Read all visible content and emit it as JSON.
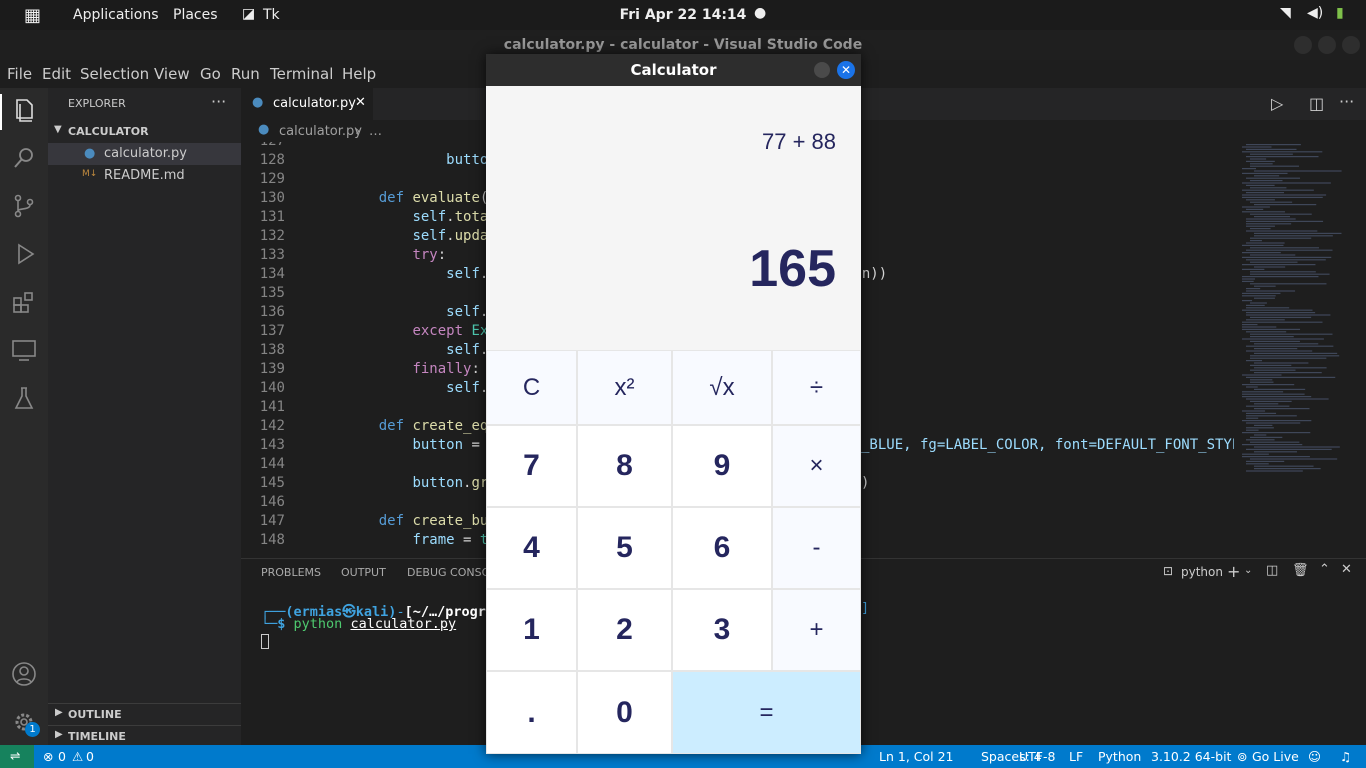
{
  "topbar": {
    "applications": "Applications",
    "places": "Places",
    "app": "Tk",
    "clock": "Fri Apr 22  14:14"
  },
  "window": {
    "title": "calculator.py - calculator - Visual Studio Code"
  },
  "menu": [
    "File",
    "Edit",
    "Selection",
    "View",
    "Go",
    "Run",
    "Terminal",
    "Help"
  ],
  "explorer": {
    "header": "EXPLORER",
    "folder": "CALCULATOR",
    "files": [
      "calculator.py",
      "README.md"
    ],
    "outline": "OUTLINE",
    "timeline": "TIMELINE"
  },
  "editor": {
    "tab": "calculator.py",
    "breadcrumb_file": "calculator.py",
    "breadcrumb_more": "…",
    "lines": [
      {
        "n": "127",
        "i": "",
        "t": ""
      },
      {
        "n": "128",
        "i": "            ",
        "t": "button.grid(r"
      },
      {
        "n": "129",
        "i": "",
        "t": ""
      },
      {
        "n": "130",
        "i": "    ",
        "t": "def evaluate(self"
      },
      {
        "n": "131",
        "i": "        ",
        "t": "self.total_ex"
      },
      {
        "n": "132",
        "i": "        ",
        "t": "self.update_t"
      },
      {
        "n": "133",
        "i": "        ",
        "t": "try:"
      },
      {
        "n": "134",
        "i": "            ",
        "t": "self.curr"
      },
      {
        "n": "135",
        "i": "",
        "t": ""
      },
      {
        "n": "136",
        "i": "            ",
        "t": "self.tota"
      },
      {
        "n": "137",
        "i": "        ",
        "t": "except Except"
      },
      {
        "n": "138",
        "i": "            ",
        "t": "self.curr"
      },
      {
        "n": "139",
        "i": "        ",
        "t": "finally:"
      },
      {
        "n": "140",
        "i": "            ",
        "t": "self.upda"
      },
      {
        "n": "141",
        "i": "",
        "t": ""
      },
      {
        "n": "142",
        "i": "    ",
        "t": "def create_equals"
      },
      {
        "n": "143",
        "i": "        ",
        "t": "button = tk.E"
      },
      {
        "n": "144",
        "i": "",
        "t": ""
      },
      {
        "n": "145",
        "i": "        ",
        "t": "button.grid(r"
      },
      {
        "n": "146",
        "i": "",
        "t": ""
      },
      {
        "n": "147",
        "i": "    ",
        "t": "def create_button"
      },
      {
        "n": "148",
        "i": "        ",
        "t": "frame = tk.Fr"
      }
    ],
    "tail_134": "ion))",
    "tail_143": "_BLUE, fg=LABEL_COLOR, font=DEFAULT_FONT_STYL",
    "tail_145": ")"
  },
  "panel": {
    "tabs": [
      "PROBLEMS",
      "OUTPUT",
      "DEBUG CONSO"
    ],
    "shell": "python",
    "prompt_user": "(ermias㉿kali)",
    "prompt_path": "[~/…/progr",
    "command": "python",
    "arg": "calculator.py"
  },
  "status": {
    "errors": "0",
    "warnings": "0",
    "position": "Ln 1, Col 21",
    "spaces": "Spaces: 4",
    "encoding": "UTF-8",
    "eol": "LF",
    "language": "Python",
    "version": "3.10.2 64-bit",
    "golive": "Go Live",
    "badge": "1"
  },
  "calculator": {
    "title": "Calculator",
    "expression": "77 + 88",
    "result": "165",
    "keys": [
      {
        "label": "C",
        "row": 0,
        "col": 0,
        "span": 1,
        "kind": "op"
      },
      {
        "label": "x²",
        "row": 0,
        "col": 1,
        "span": 1,
        "kind": "op"
      },
      {
        "label": "√x",
        "row": 0,
        "col": 2,
        "span": 1,
        "kind": "op"
      },
      {
        "label": "÷",
        "row": 0,
        "col": 3,
        "span": 1,
        "kind": "op"
      },
      {
        "label": "7",
        "row": 1,
        "col": 0,
        "span": 1,
        "kind": "digit"
      },
      {
        "label": "8",
        "row": 1,
        "col": 1,
        "span": 1,
        "kind": "digit"
      },
      {
        "label": "9",
        "row": 1,
        "col": 2,
        "span": 1,
        "kind": "digit"
      },
      {
        "label": "×",
        "row": 1,
        "col": 3,
        "span": 1,
        "kind": "op"
      },
      {
        "label": "4",
        "row": 2,
        "col": 0,
        "span": 1,
        "kind": "digit"
      },
      {
        "label": "5",
        "row": 2,
        "col": 1,
        "span": 1,
        "kind": "digit"
      },
      {
        "label": "6",
        "row": 2,
        "col": 2,
        "span": 1,
        "kind": "digit"
      },
      {
        "label": "-",
        "row": 2,
        "col": 3,
        "span": 1,
        "kind": "op"
      },
      {
        "label": "1",
        "row": 3,
        "col": 0,
        "span": 1,
        "kind": "digit"
      },
      {
        "label": "2",
        "row": 3,
        "col": 1,
        "span": 1,
        "kind": "digit"
      },
      {
        "label": "3",
        "row": 3,
        "col": 2,
        "span": 1,
        "kind": "digit"
      },
      {
        "label": "+",
        "row": 3,
        "col": 3,
        "span": 1,
        "kind": "op"
      },
      {
        "label": ".",
        "row": 4,
        "col": 0,
        "span": 1,
        "kind": "digit"
      },
      {
        "label": "0",
        "row": 4,
        "col": 1,
        "span": 1,
        "kind": "digit"
      },
      {
        "label": "=",
        "row": 4,
        "col": 2,
        "span": 2,
        "kind": "equals"
      }
    ],
    "colors": {
      "digit": "#ffffff",
      "op": "#f8faff",
      "equals": "#ccedff",
      "text": "#25265e"
    }
  },
  "colors": {
    "accent": "#007acc"
  }
}
